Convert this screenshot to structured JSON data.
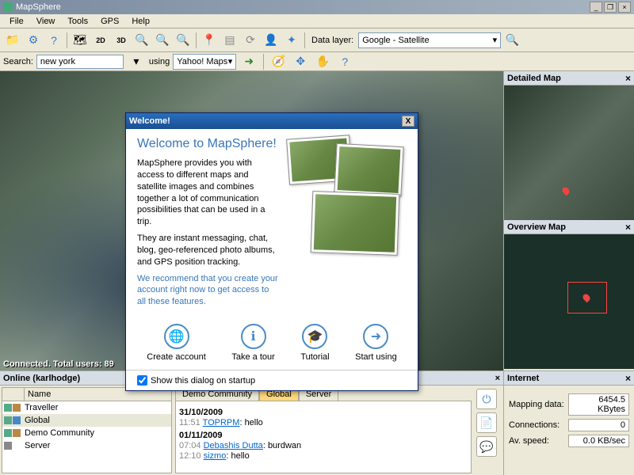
{
  "app": {
    "title": "MapSphere"
  },
  "menu": [
    "File",
    "View",
    "Tools",
    "GPS",
    "Help"
  ],
  "toolbar": {
    "data_layer_label": "Data layer:",
    "data_layer_value": "Google - Satellite"
  },
  "search": {
    "label": "Search:",
    "value": "new york",
    "using_label": "using",
    "engine_value": "Yahoo! Maps"
  },
  "map_status": "Connected. Total users: 89",
  "panels": {
    "detailed": "Detailed Map",
    "overview": "Overview Map",
    "internet": "Internet"
  },
  "internet": {
    "mapping_label": "Mapping data:",
    "mapping_val": "6454.5 KBytes",
    "conn_label": "Connections:",
    "conn_val": "0",
    "speed_label": "Av. speed:",
    "speed_val": "0.0 KB/sec"
  },
  "online": {
    "header": "Online (karlhodge)",
    "col_name": "Name",
    "users": [
      "Traveller",
      "Global",
      "Demo Community",
      "Server"
    ],
    "tabs": [
      "Demo Community",
      "Global",
      "Server"
    ],
    "messages": [
      {
        "date": "31/10/2009",
        "entries": [
          {
            "time": "11:51",
            "user": "TOPRPM",
            "text": "hello"
          }
        ]
      },
      {
        "date": "01/11/2009",
        "entries": [
          {
            "time": "07:04",
            "user": "Debashis Dutta",
            "text": "burdwan"
          },
          {
            "time": "12:10",
            "user": "sizmo",
            "text": "hello"
          }
        ]
      }
    ]
  },
  "welcome": {
    "title": "Welcome!",
    "heading": "Welcome to MapSphere!",
    "p1": "MapSphere provides you with access to different maps and satellite images and combines together a lot of communication possibilities that can be used in a trip.",
    "p2": "They are instant messaging, chat, blog, geo-referenced photo albums, and GPS position tracking.",
    "rec": "We recommend that you create your account right now to get access to all these features.",
    "actions": [
      "Create account",
      "Take a tour",
      "Tutorial",
      "Start using"
    ],
    "checkbox": "Show this dialog on startup"
  }
}
